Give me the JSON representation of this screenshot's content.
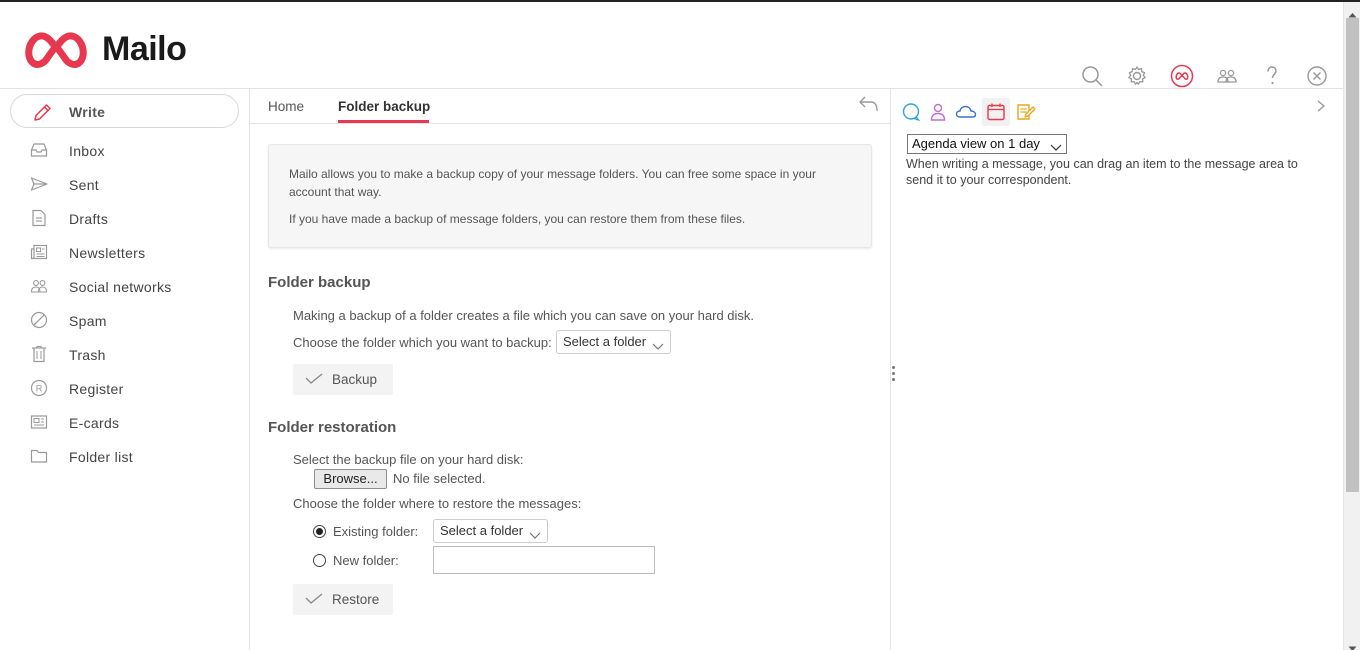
{
  "app": {
    "logo_text": "Mailo",
    "brand_color": "#e8384f"
  },
  "header_icons": [
    "search-icon",
    "settings-icon",
    "mailo-account-icon",
    "contacts-icon",
    "help-icon",
    "close-icon"
  ],
  "sidebar": {
    "write_label": "Write",
    "items": [
      {
        "label": "Inbox",
        "icon": "inbox-icon"
      },
      {
        "label": "Sent",
        "icon": "sent-icon"
      },
      {
        "label": "Drafts",
        "icon": "drafts-icon"
      },
      {
        "label": "Newsletters",
        "icon": "newsletters-icon"
      },
      {
        "label": "Social networks",
        "icon": "social-networks-icon"
      },
      {
        "label": "Spam",
        "icon": "spam-icon"
      },
      {
        "label": "Trash",
        "icon": "trash-icon"
      },
      {
        "label": "Register",
        "icon": "register-icon"
      },
      {
        "label": "E-cards",
        "icon": "ecards-icon"
      },
      {
        "label": "Folder list",
        "icon": "folder-icon"
      }
    ]
  },
  "tabs": {
    "home": "Home",
    "folder_backup": "Folder backup"
  },
  "info": {
    "line1": "Mailo allows you to make a backup copy of your message folders. You can free some space in your account that way.",
    "line2": "If you have made a backup of message folders, you can restore them from these files."
  },
  "backup": {
    "title": "Folder backup",
    "description": "Making a backup of a folder creates a file which you can save on your hard disk.",
    "choose_label": "Choose the folder which you want to backup:",
    "select_value": "Select a folder",
    "button_label": "Backup"
  },
  "restore": {
    "title": "Folder restoration",
    "select_file_label": "Select the backup file on your hard disk:",
    "browse_label": "Browse...",
    "no_file": "No file selected.",
    "choose_label": "Choose the folder where to restore the messages:",
    "existing_label": "Existing folder:",
    "existing_select_value": "Select a folder",
    "new_label": "New folder:",
    "new_value": "",
    "button_label": "Restore",
    "selected_option": "existing"
  },
  "right_panel": {
    "tabs": [
      "chat-icon",
      "contacts-person-icon",
      "cloud-icon",
      "calendar-icon",
      "notes-icon"
    ],
    "active_tab": "calendar-icon",
    "agenda_select": "Agenda view on 1 day",
    "hint": "When writing a message, you can drag an item to the message area to send it to your correspondent."
  }
}
